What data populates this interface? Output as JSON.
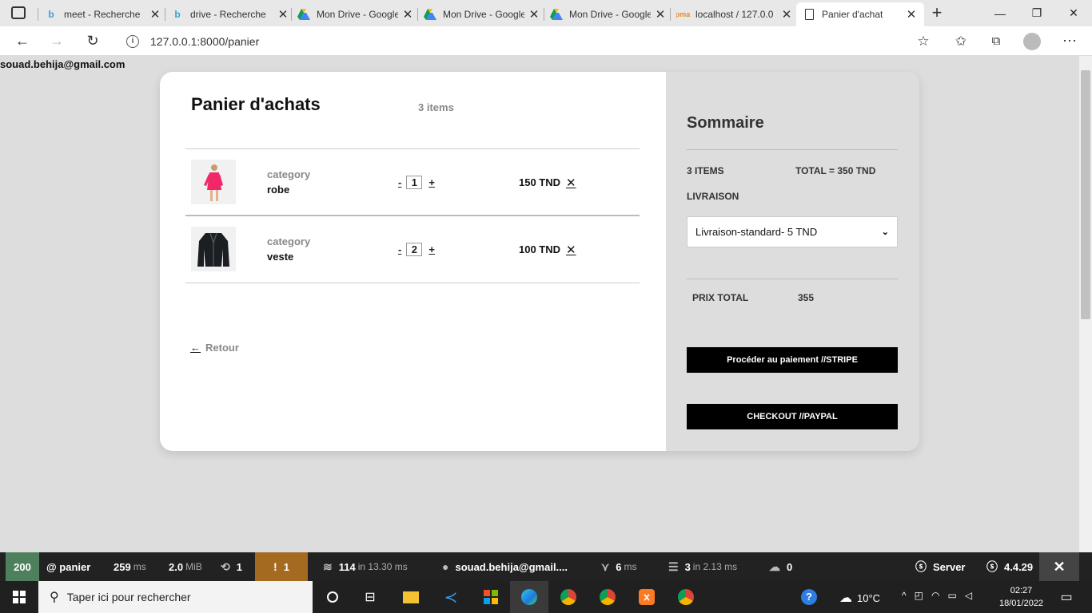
{
  "browser": {
    "tabs": [
      {
        "title": "meet - Recherche",
        "icon": "bing-icon"
      },
      {
        "title": "drive - Recherche",
        "icon": "bing-icon"
      },
      {
        "title": "Mon Drive - Google",
        "icon": "drive-icon"
      },
      {
        "title": "Mon Drive - Google",
        "icon": "drive-icon"
      },
      {
        "title": "Mon Drive - Google",
        "icon": "drive-icon"
      },
      {
        "title": "localhost / 127.0.0",
        "icon": "phpmyadmin-icon"
      },
      {
        "title": "Panier d'achat",
        "icon": "page-icon",
        "active": true
      }
    ],
    "url": "127.0.0.1:8000/panier"
  },
  "page": {
    "user_email": "souad.behija@gmail.com",
    "cart_title": "Panier d'achats",
    "item_count": "3 items",
    "items": [
      {
        "category": "category",
        "name": "robe",
        "qty": "1",
        "price": "150 TND",
        "minus": "-",
        "plus": "+",
        "remove": "✕",
        "image": "pink-dress-photo"
      },
      {
        "category": "category",
        "name": "veste",
        "qty": "2",
        "price": "100 TND",
        "minus": "-",
        "plus": "+",
        "remove": "✕",
        "image": "black-leather-jacket-photo"
      }
    ],
    "back_label": "Retour",
    "back_arrow": "←"
  },
  "summary": {
    "title": "Sommaire",
    "items_label": "3 ITEMS",
    "total_label": "TOTAL = 350 TND",
    "shipping_label": "LIVRAISON",
    "shipping_selected": "Livraison-standard- 5 TND",
    "grand_total_label": "PRIX TOTAL",
    "grand_total_value": "355",
    "stripe_button": "Procéder au paiement //STRIPE",
    "paypal_button": "CHECKOUT //PAYPAL"
  },
  "sf_toolbar": {
    "status": "200",
    "route": "@ panier",
    "time_value": "259",
    "time_unit": "ms",
    "memory_value": "2.0",
    "memory_unit": "MiB",
    "forms": "1",
    "logs": "1",
    "cache_value": "114",
    "cache_unit": "in 13.30 ms",
    "user": "souad.behija@gmail....",
    "twig_value": "6",
    "twig_unit": "ms",
    "db_value": "3",
    "db_unit": "in 2.13 ms",
    "ajax": "0",
    "server_label": "Server",
    "version": "4.4.29",
    "status_color": "#4f805d",
    "logs_color": "#a46a1f"
  },
  "taskbar": {
    "search_placeholder": "Taper ici pour rechercher",
    "weather": "10°C",
    "time": "02:27",
    "date": "18/01/2022"
  }
}
